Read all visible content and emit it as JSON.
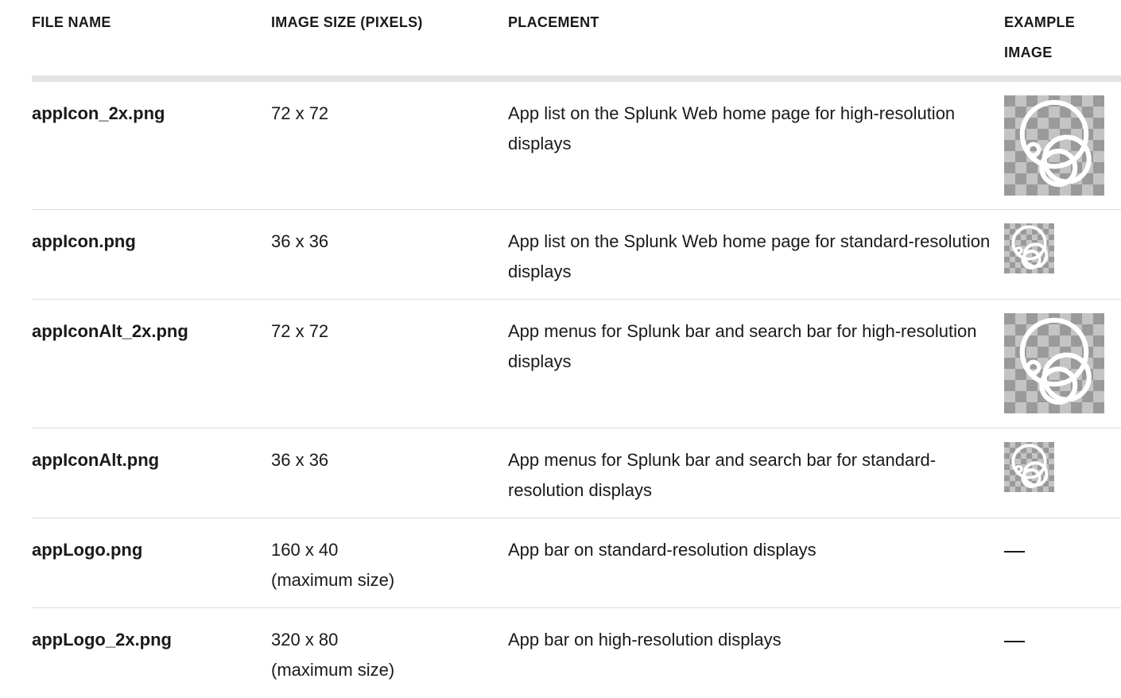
{
  "headers": {
    "file_name": "FILE NAME",
    "image_size": "IMAGE SIZE (PIXELS)",
    "placement": "PLACEMENT",
    "example_image_line1": "EXAMPLE",
    "example_image_line2": "IMAGE"
  },
  "rows": [
    {
      "file_name": "appIcon_2x.png",
      "size_line1": "72 x 72",
      "size_line2": "",
      "placement": "App list on the Splunk Web home page for high-resolution displays",
      "example": "app-icon-large"
    },
    {
      "file_name": "appIcon.png",
      "size_line1": "36 x 36",
      "size_line2": "",
      "placement": "App list on the Splunk Web home page for standard-resolution displays",
      "example": "app-icon-small"
    },
    {
      "file_name": "appIconAlt_2x.png",
      "size_line1": "72 x 72",
      "size_line2": "",
      "placement": "App menus for Splunk bar and search bar for high-resolution displays",
      "example": "app-icon-large"
    },
    {
      "file_name": "appIconAlt.png",
      "size_line1": "36 x 36",
      "size_line2": "",
      "placement": "App menus for Splunk bar and search bar for standard-resolution displays",
      "example": "app-icon-small"
    },
    {
      "file_name": "appLogo.png",
      "size_line1": "160 x 40",
      "size_line2": "(maximum size)",
      "placement": "App bar on standard-resolution displays",
      "example": "—"
    },
    {
      "file_name": "appLogo_2x.png",
      "size_line1": "320 x 80",
      "size_line2": "(maximum size)",
      "placement": "App bar on high-resolution displays",
      "example": "—"
    }
  ]
}
